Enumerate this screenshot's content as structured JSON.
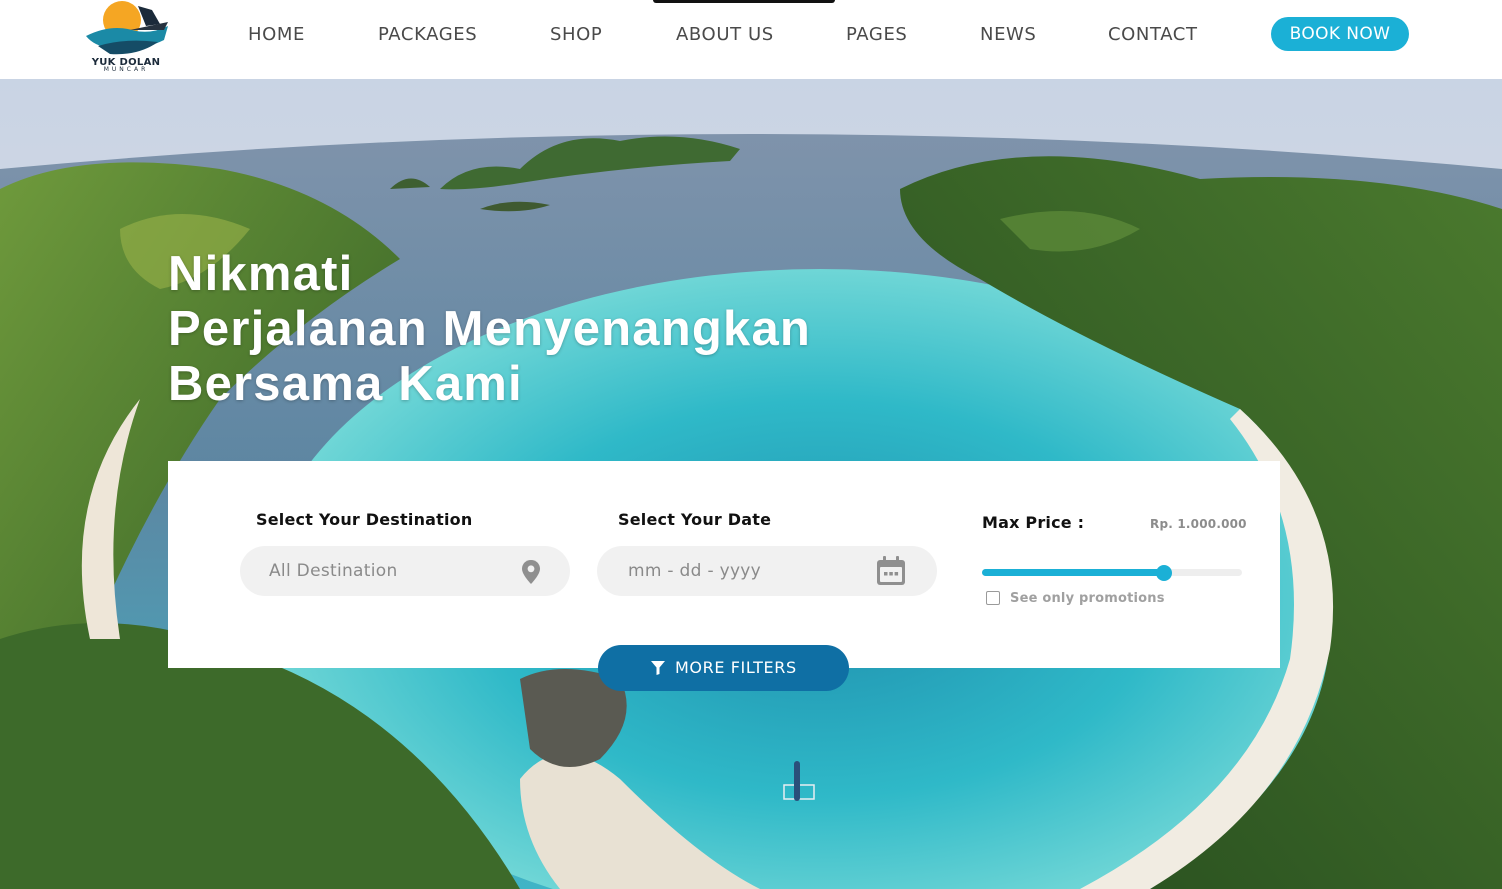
{
  "brand": {
    "name": "YUK DOLAN",
    "sub": "MUNCAR"
  },
  "nav": {
    "items": [
      {
        "label": "HOME"
      },
      {
        "label": "PACKAGES"
      },
      {
        "label": "SHOP"
      },
      {
        "label": "ABOUT US"
      },
      {
        "label": "PAGES"
      },
      {
        "label": "NEWS"
      },
      {
        "label": "CONTACT"
      }
    ],
    "active": "ABOUT US",
    "book_label": "BOOK NOW"
  },
  "hero": {
    "title_lines": [
      "Nikmati",
      "Perjalanan Menyenangkan",
      "Bersama Kami"
    ]
  },
  "search": {
    "destination": {
      "label": "Select Your Destination",
      "placeholder": "All Destination",
      "icon": "map-pin-icon"
    },
    "date": {
      "label": "Select Your Date",
      "placeholder": "mm - dd - yyyy",
      "icon": "calendar-icon"
    },
    "price": {
      "label": "Max Price :",
      "value_text": "Rp. 1.000.000",
      "slider_fraction": 0.7
    },
    "promotions": {
      "label": "See only promotions",
      "checked": false
    },
    "more_filters": {
      "label": "MORE FILTERS",
      "icon": "filter-icon"
    }
  },
  "colors": {
    "accent": "#1bb0d6",
    "button_dark": "#0f6fa4",
    "nav_text": "#4a4a4a"
  }
}
